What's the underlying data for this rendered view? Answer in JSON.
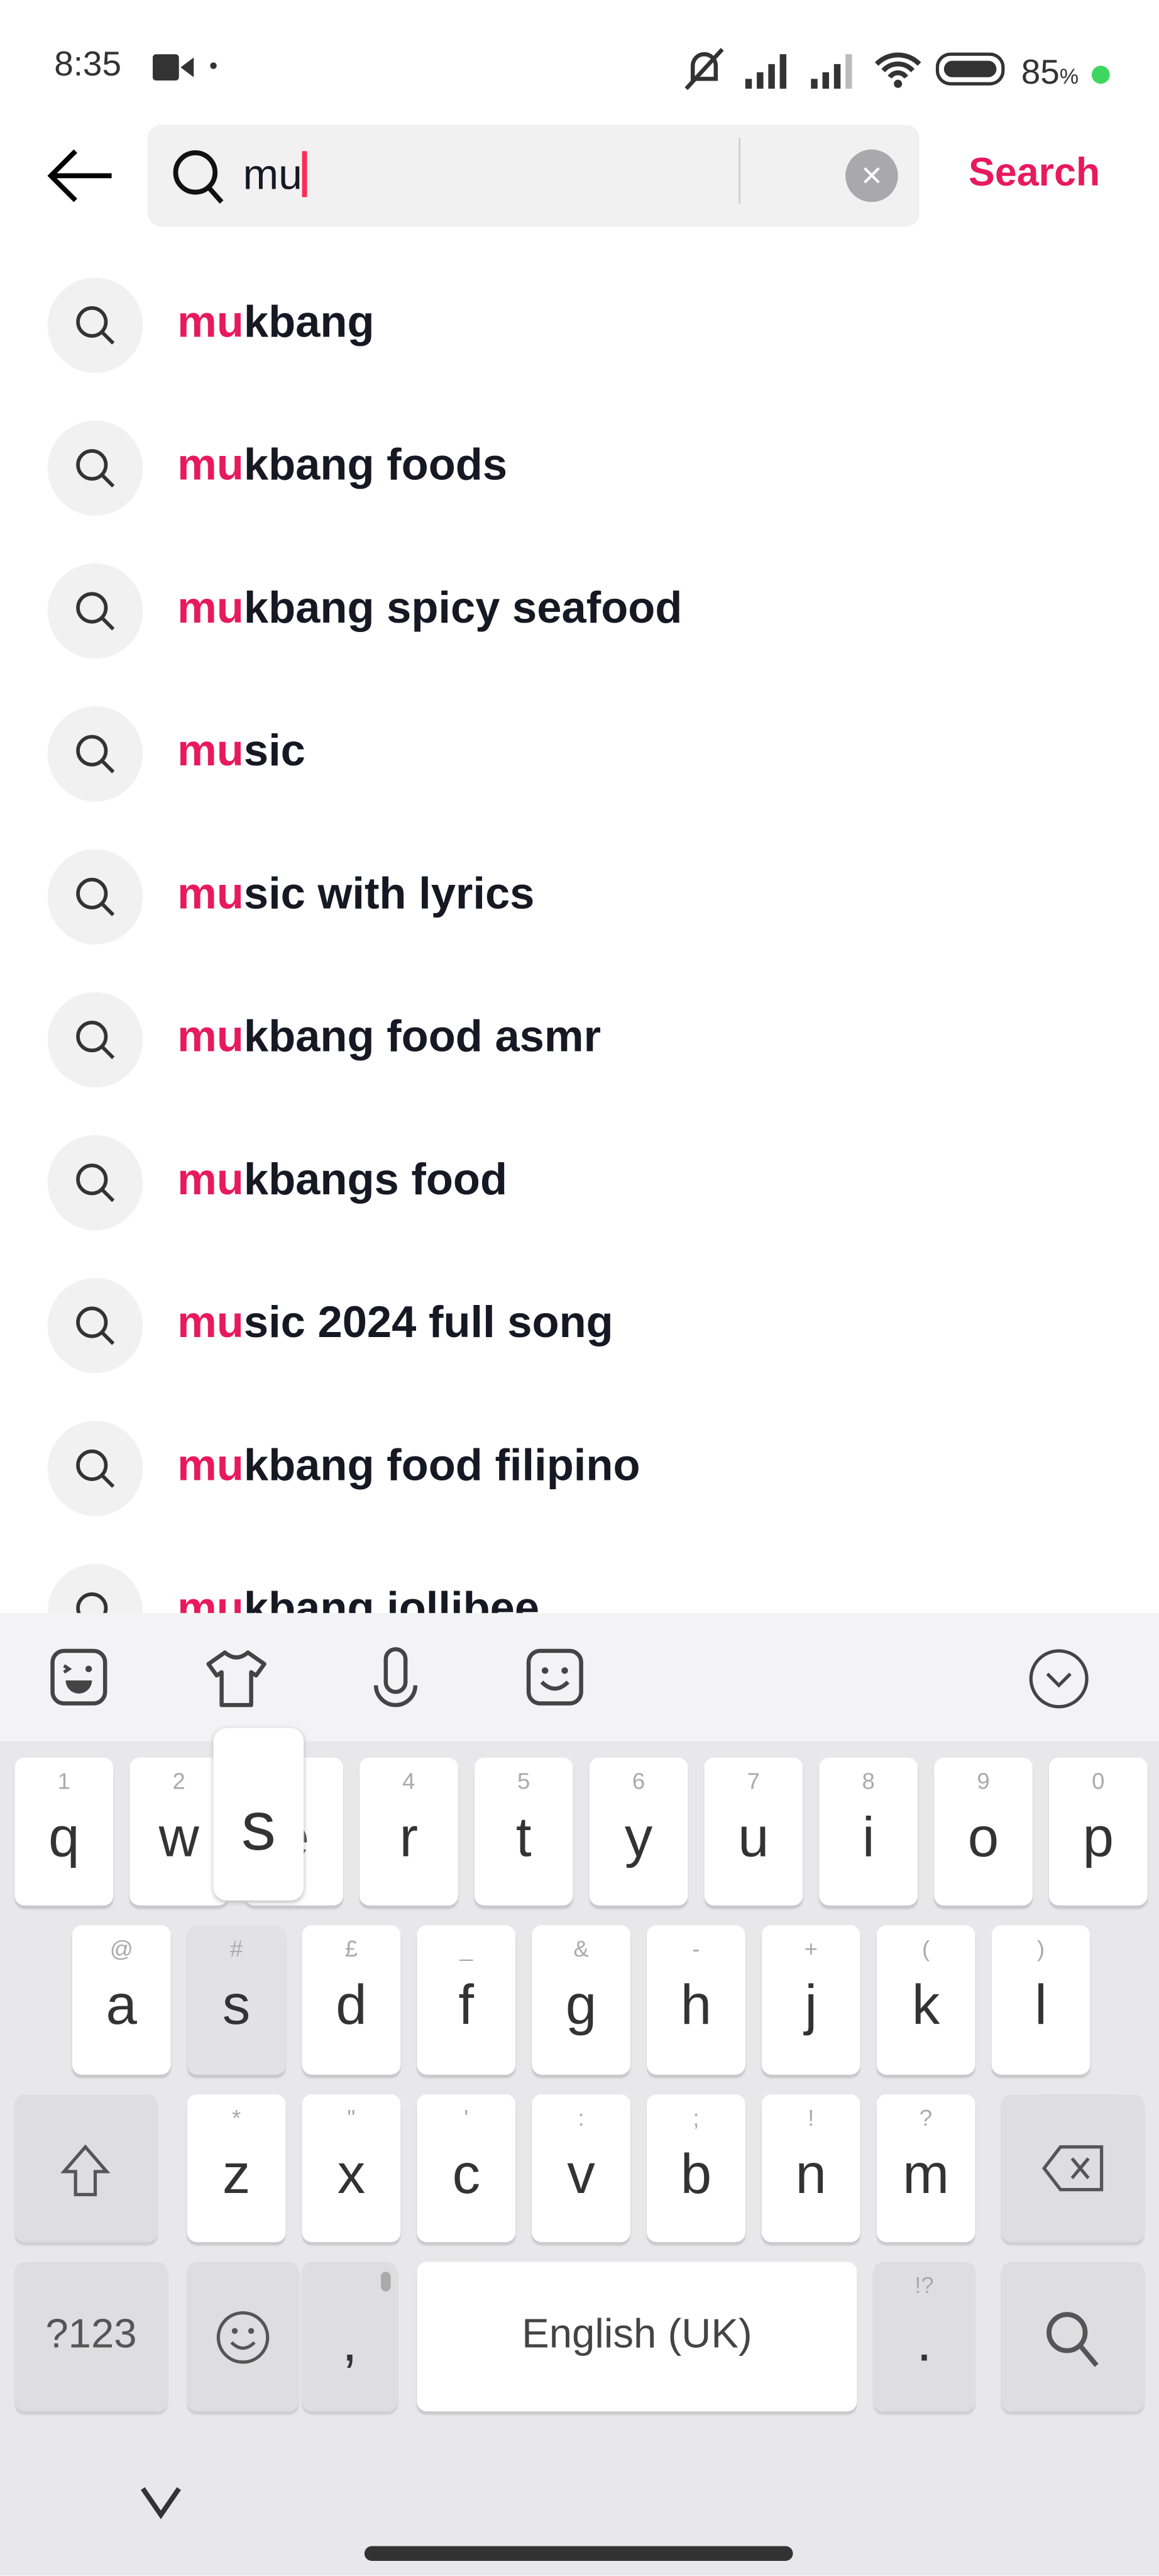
{
  "status_bar": {
    "time": "8:35",
    "battery": "85",
    "battery_unit": "%",
    "icons": [
      "video-icon",
      "dot-icon",
      "mute-icon",
      "signal-icon",
      "signal-icon",
      "wifi-icon",
      "battery-icon",
      "charging-dot-icon"
    ]
  },
  "search": {
    "query": "mu",
    "search_label": "Search",
    "accent": "#e8195d"
  },
  "suggestions": [
    {
      "match": "mu",
      "rest": "kbang"
    },
    {
      "match": "mu",
      "rest": "kbang foods"
    },
    {
      "match": "mu",
      "rest": "kbang spicy seafood"
    },
    {
      "match": "mu",
      "rest": "sic"
    },
    {
      "match": "mu",
      "rest": "sic with lyrics"
    },
    {
      "match": "mu",
      "rest": "kbang food asmr"
    },
    {
      "match": "mu",
      "rest": "kbangs food"
    },
    {
      "match": "mu",
      "rest": "sic 2024 full song"
    },
    {
      "match": "mu",
      "rest": "kbang food filipino"
    },
    {
      "match": "mu",
      "rest": "kbang jollibee"
    }
  ],
  "keyboard": {
    "toolbar_icons": [
      "sticker-icon",
      "theme-shirt-icon",
      "microphone-icon",
      "emoji-sticker-icon",
      "collapse-chevron-icon"
    ],
    "row1": [
      {
        "k": "q",
        "s": "1"
      },
      {
        "k": "w",
        "s": "2"
      },
      {
        "k": "e",
        "s": "3"
      },
      {
        "k": "r",
        "s": "4"
      },
      {
        "k": "t",
        "s": "5"
      },
      {
        "k": "y",
        "s": "6"
      },
      {
        "k": "u",
        "s": "7"
      },
      {
        "k": "i",
        "s": "8"
      },
      {
        "k": "o",
        "s": "9"
      },
      {
        "k": "p",
        "s": "0"
      }
    ],
    "row2": [
      {
        "k": "a",
        "s": "@"
      },
      {
        "k": "s",
        "s": "#"
      },
      {
        "k": "d",
        "s": "£"
      },
      {
        "k": "f",
        "s": "_"
      },
      {
        "k": "g",
        "s": "&"
      },
      {
        "k": "h",
        "s": "-"
      },
      {
        "k": "j",
        "s": "+"
      },
      {
        "k": "k",
        "s": "("
      },
      {
        "k": "l",
        "s": ")"
      }
    ],
    "row3": [
      {
        "k": "z",
        "s": "*"
      },
      {
        "k": "x",
        "s": "\""
      },
      {
        "k": "c",
        "s": "'"
      },
      {
        "k": "v",
        "s": ":"
      },
      {
        "k": "b",
        "s": ";"
      },
      {
        "k": "n",
        "s": "!"
      },
      {
        "k": "m",
        "s": "?"
      }
    ],
    "symbols_label": "?123",
    "comma": ",",
    "space_label": "English (UK)",
    "period": ".",
    "period_sub": "!?",
    "popup_key": "s",
    "pressed_key": "s"
  }
}
